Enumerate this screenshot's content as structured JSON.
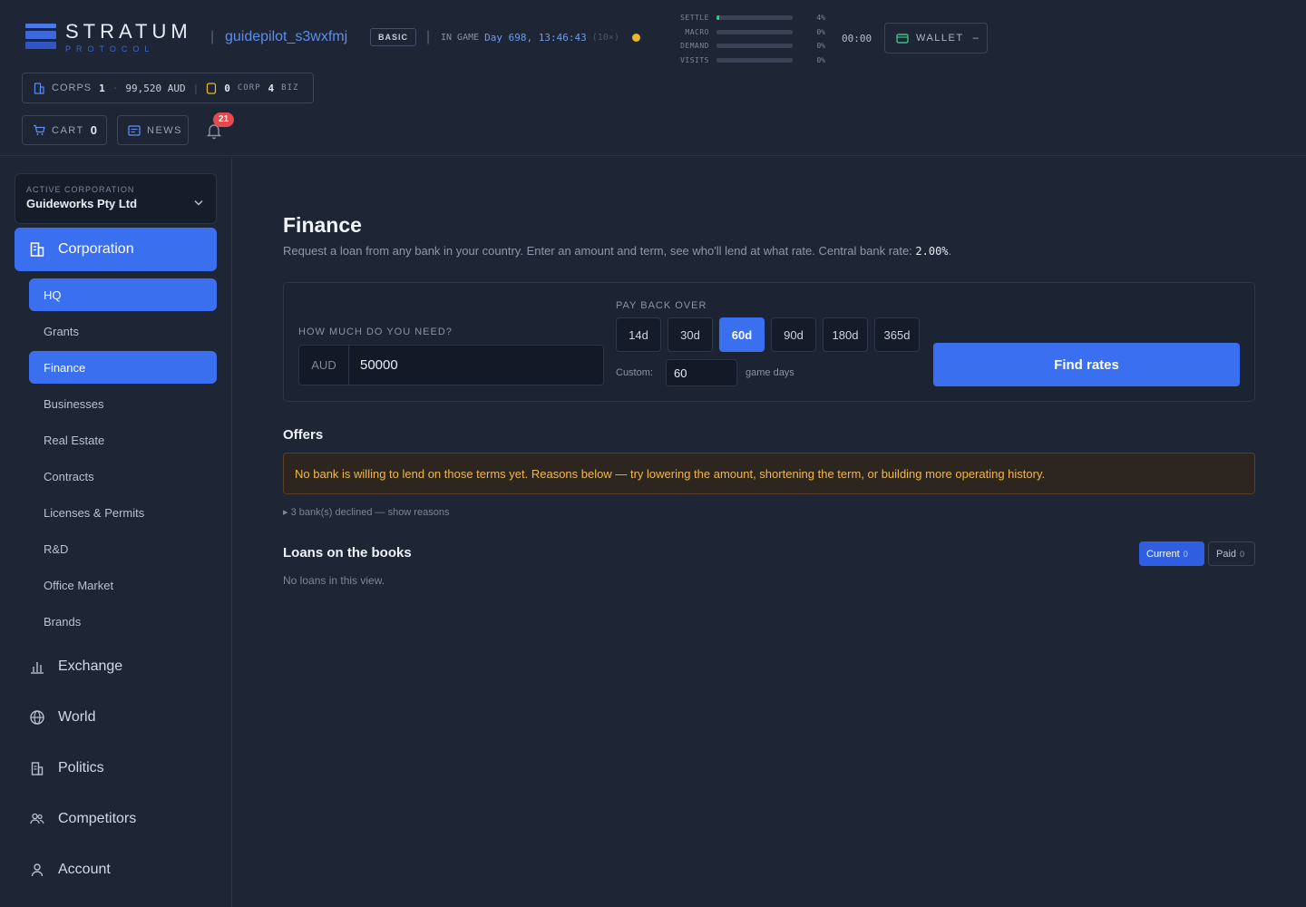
{
  "header": {
    "logo_title": "STRATUM",
    "logo_subtitle": "PROTOCOL",
    "username": "guidepilot_s3wxfmj",
    "plan": "BASIC",
    "in_game_label": "IN GAME",
    "game_day": "Day 698, 13:46:43",
    "speed": "(10×)",
    "meters": [
      {
        "label": "SETTLE",
        "pct": "4%",
        "fill": 4
      },
      {
        "label": "MACRO",
        "pct": "0%",
        "fill": 0
      },
      {
        "label": "DEMAND",
        "pct": "0%",
        "fill": 0
      },
      {
        "label": "VISITS",
        "pct": "0%",
        "fill": 0
      }
    ],
    "clock": "00:00",
    "wallet_label": "WALLET",
    "wallet_value": "–",
    "corps_label": "CORPS",
    "corps_count": "1",
    "corps_dot": "·",
    "balance": "99,520 AUD",
    "corp_count": "0",
    "corp_label": "CORP",
    "biz_count": "4",
    "biz_label": "BIZ",
    "cart_label": "CART",
    "cart_count": "0",
    "news_label": "NEWS",
    "notifications": "21"
  },
  "sidebar": {
    "active_corp_label": "ACTIVE CORPORATION",
    "active_corp_name": "Guideworks Pty Ltd",
    "corporation": "Corporation",
    "sub_items": [
      "HQ",
      "Grants",
      "Finance",
      "Businesses",
      "Real Estate",
      "Contracts",
      "Licenses & Permits",
      "R&D",
      "Office Market",
      "Brands"
    ],
    "sections": [
      "Exchange",
      "World",
      "Politics",
      "Competitors",
      "Account"
    ]
  },
  "main": {
    "title": "Finance",
    "subtitle": "Request a loan from any bank in your country. Enter an amount and term, see who'll lend at what rate. Central bank rate: ",
    "central_rate": "2.00%",
    "subtitle_end": ".",
    "amount_label": "HOW MUCH DO YOU NEED?",
    "currency": "AUD",
    "amount": "50000",
    "payback_label": "PAY BACK OVER",
    "terms": [
      "14d",
      "30d",
      "60d",
      "90d",
      "180d",
      "365d"
    ],
    "selected_term": "60d",
    "custom_label": "Custom:",
    "custom_value": "60",
    "game_days_label": "game days",
    "find_button": "Find rates",
    "offers_title": "Offers",
    "warning": "No bank is willing to lend on those terms yet. Reasons below — try lowering the amount, shortening the term, or building more operating history.",
    "declined": "▸ 3 bank(s) declined — show reasons",
    "loans_title": "Loans on the books",
    "no_loans": "No loans in this view.",
    "filter_current": "Current",
    "filter_current_count": "0",
    "filter_paid": "Paid",
    "filter_paid_count": "0"
  },
  "colors": {
    "accent": "#3a6ff0",
    "warning_text": "#f0b84a",
    "badge": "#e5484d",
    "meter_fill": "#3fbf8a"
  }
}
